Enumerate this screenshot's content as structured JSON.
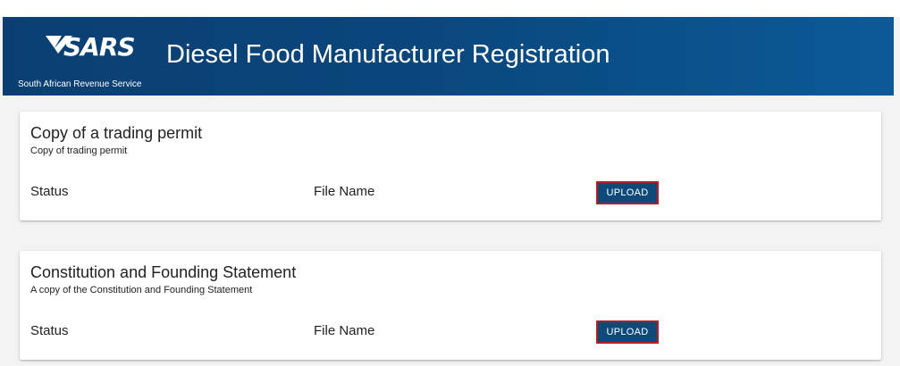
{
  "header": {
    "logo_text": "SARS",
    "logo_subtitle": "South African Revenue Service",
    "title": "Diesel Food Manufacturer Registration",
    "gradient_colors": [
      "#0b3f72",
      "#0b5a97"
    ]
  },
  "cards": [
    {
      "title": "Copy of a trading permit",
      "subtitle": "Copy of trading permit",
      "status_label": "Status",
      "file_name_label": "File Name",
      "upload_label": "UPLOAD"
    },
    {
      "title": "Constitution and Founding Statement",
      "subtitle": "A copy of the Constitution and Founding Statement",
      "status_label": "Status",
      "file_name_label": "File Name",
      "upload_label": "UPLOAD"
    }
  ],
  "colors": {
    "button_bg": "#0d4a7a",
    "button_border": "#b21f24",
    "page_bg": "#f3f3f3"
  }
}
